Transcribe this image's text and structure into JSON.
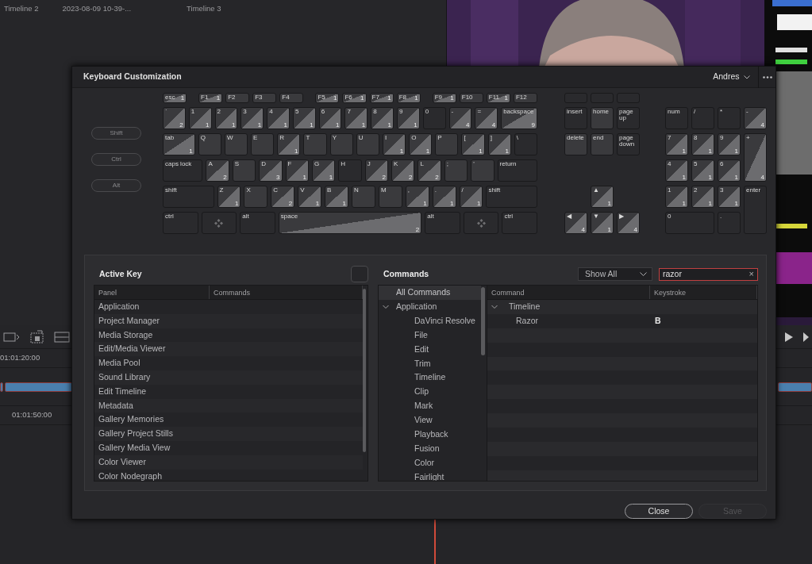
{
  "media_pool": {
    "clips": [
      {
        "name": "Timeline 2"
      },
      {
        "name": "2023-08-09 10-39-..."
      },
      {
        "name": "Timeline 3"
      }
    ]
  },
  "timeline": {
    "timecodes": [
      "01:01:20:00",
      "01:01:50:00"
    ]
  },
  "dialog": {
    "title": "Keyboard Customization",
    "preset": "Andres",
    "modifiers": [
      {
        "label": "Shift"
      },
      {
        "label": "Ctrl"
      },
      {
        "label": "Alt"
      }
    ],
    "keyboard": {
      "main": [
        [
          {
            "kind": "key",
            "label": "esc",
            "count": "1"
          },
          {
            "kind": "key",
            "label": "F1",
            "count": "1"
          },
          {
            "kind": "key",
            "label": "F2"
          },
          {
            "kind": "key",
            "label": "F3"
          },
          {
            "kind": "key",
            "label": "F4"
          },
          {
            "kind": "key",
            "label": "F5",
            "count": "1"
          },
          {
            "kind": "key",
            "label": "F6",
            "count": "1"
          },
          {
            "kind": "key",
            "label": "F7",
            "count": "1"
          },
          {
            "kind": "key",
            "label": "F8",
            "count": "1"
          },
          {
            "kind": "key",
            "label": "F9",
            "count": "1"
          },
          {
            "kind": "key",
            "label": "F10"
          },
          {
            "kind": "key",
            "label": "F11",
            "count": "1"
          },
          {
            "kind": "key",
            "label": "F12"
          }
        ],
        [
          {
            "kind": "key",
            "label": "`",
            "count": "2"
          },
          {
            "kind": "key",
            "label": "1",
            "count": "1"
          },
          {
            "kind": "key",
            "label": "2",
            "count": "1"
          },
          {
            "kind": "key",
            "label": "3",
            "count": "1"
          },
          {
            "kind": "key",
            "label": "4",
            "count": "1"
          },
          {
            "kind": "key",
            "label": "5",
            "count": "1"
          },
          {
            "kind": "key",
            "label": "6",
            "count": "1"
          },
          {
            "kind": "key",
            "label": "7",
            "count": "1"
          },
          {
            "kind": "key",
            "label": "8",
            "count": "1"
          },
          {
            "kind": "key",
            "label": "9",
            "count": "1"
          },
          {
            "kind": "key",
            "label": "0",
            "dim": true
          },
          {
            "kind": "key",
            "label": "-",
            "count": "4"
          },
          {
            "kind": "key",
            "label": "=",
            "count": "4"
          },
          {
            "kind": "key",
            "label": "backspace",
            "count": "9"
          }
        ],
        [
          {
            "kind": "key",
            "label": "tab",
            "count": "1"
          },
          {
            "kind": "key",
            "label": "Q"
          },
          {
            "kind": "key",
            "label": "W"
          },
          {
            "kind": "key",
            "label": "E"
          },
          {
            "kind": "key",
            "label": "R",
            "count": "1"
          },
          {
            "kind": "key",
            "label": "T"
          },
          {
            "kind": "key",
            "label": "Y"
          },
          {
            "kind": "key",
            "label": "U"
          },
          {
            "kind": "key",
            "label": "I",
            "count": "1"
          },
          {
            "kind": "key",
            "label": "O",
            "count": "1"
          },
          {
            "kind": "key",
            "label": "P"
          },
          {
            "kind": "key",
            "label": "[",
            "count": "1"
          },
          {
            "kind": "key",
            "label": "]",
            "count": "1"
          },
          {
            "kind": "key",
            "label": "\\",
            "dim": true
          }
        ],
        [
          {
            "kind": "key",
            "label": "caps lock",
            "dim": true
          },
          {
            "kind": "key",
            "label": "A",
            "count": "2"
          },
          {
            "kind": "key",
            "label": "S"
          },
          {
            "kind": "key",
            "label": "D",
            "count": "3"
          },
          {
            "kind": "key",
            "label": "F",
            "count": "1"
          },
          {
            "kind": "key",
            "label": "G",
            "count": "1"
          },
          {
            "kind": "key",
            "label": "H",
            "dim": true
          },
          {
            "kind": "key",
            "label": "J",
            "count": "2"
          },
          {
            "kind": "key",
            "label": "K",
            "count": "2"
          },
          {
            "kind": "key",
            "label": "L",
            "count": "2"
          },
          {
            "kind": "key",
            "label": ";"
          },
          {
            "kind": "key",
            "label": "'"
          },
          {
            "kind": "key",
            "label": "return",
            "dim": true
          }
        ],
        [
          {
            "kind": "key",
            "label": "shift",
            "dim": true
          },
          {
            "kind": "key",
            "label": "Z",
            "count": "1"
          },
          {
            "kind": "key",
            "label": "X"
          },
          {
            "kind": "key",
            "label": "C",
            "count": "2"
          },
          {
            "kind": "key",
            "label": "V",
            "count": "1"
          },
          {
            "kind": "key",
            "label": "B",
            "count": "1"
          },
          {
            "kind": "key",
            "label": "N"
          },
          {
            "kind": "key",
            "label": "M"
          },
          {
            "kind": "key",
            "label": ",",
            "count": "1"
          },
          {
            "kind": "key",
            "label": ".",
            "count": "1"
          },
          {
            "kind": "key",
            "label": "/",
            "count": "1"
          },
          {
            "kind": "key",
            "label": "shift",
            "dim": true
          }
        ],
        [
          {
            "kind": "key",
            "label": "ctrl",
            "dim": true
          },
          {
            "kind": "icon",
            "dim": true
          },
          {
            "kind": "key",
            "label": "alt",
            "dim": true
          },
          {
            "kind": "key",
            "label": "space",
            "count": "2"
          },
          {
            "kind": "key",
            "label": "alt",
            "dim": true
          },
          {
            "kind": "icon",
            "dim": true
          },
          {
            "kind": "key",
            "label": "ctrl",
            "dim": true
          }
        ]
      ],
      "nav": [
        {
          "kind": "blank",
          "dim": true
        },
        {
          "kind": "blank",
          "dim": true
        },
        {
          "kind": "blank",
          "dim": true
        },
        {
          "kind": "key",
          "label": "insert",
          "dim": true
        },
        {
          "kind": "key",
          "label": "home"
        },
        {
          "kind": "key",
          "label": "page up",
          "dim": true
        },
        {
          "kind": "key",
          "label": "delete"
        },
        {
          "kind": "key",
          "label": "end"
        },
        {
          "kind": "key",
          "label": "page down",
          "dim": true
        },
        {
          "kind": "key",
          "label": "▲",
          "count": "1"
        },
        {
          "kind": "key",
          "label": "◀",
          "count": "4"
        },
        {
          "kind": "key",
          "label": "▼",
          "count": "1"
        },
        {
          "kind": "key",
          "label": "▶",
          "count": "4"
        }
      ],
      "numpad": [
        [
          {
            "kind": "key",
            "label": "num",
            "dim": true
          },
          {
            "kind": "key",
            "label": "/",
            "dim": true
          },
          {
            "kind": "key",
            "label": "*",
            "dim": true
          },
          {
            "kind": "key",
            "label": "-",
            "count": "4"
          }
        ],
        [
          {
            "kind": "key",
            "label": "7",
            "count": "1"
          },
          {
            "kind": "key",
            "label": "8",
            "count": "1"
          },
          {
            "kind": "key",
            "label": "9",
            "count": "1"
          },
          {
            "kind": "key",
            "label": "+",
            "count": "4"
          }
        ],
        [
          {
            "kind": "key",
            "label": "4",
            "count": "1"
          },
          {
            "kind": "key",
            "label": "5",
            "count": "1"
          },
          {
            "kind": "key",
            "label": "6",
            "count": "1"
          }
        ],
        [
          {
            "kind": "key",
            "label": "1",
            "count": "1"
          },
          {
            "kind": "key",
            "label": "2",
            "count": "1"
          },
          {
            "kind": "key",
            "label": "3",
            "count": "1"
          },
          {
            "kind": "key",
            "label": "enter",
            "dim": true
          }
        ],
        [
          {
            "kind": "key",
            "label": "0",
            "dim": true
          },
          {
            "kind": "key",
            "label": ".",
            "dim": true
          }
        ]
      ]
    },
    "active_key": {
      "title": "Active Key",
      "columns": [
        "Panel",
        "Commands"
      ],
      "rows": [
        {
          "panel": "Application"
        },
        {
          "panel": "Project Manager"
        },
        {
          "panel": "Media Storage"
        },
        {
          "panel": "Edit/Media Viewer"
        },
        {
          "panel": "Media Pool"
        },
        {
          "panel": "Sound Library"
        },
        {
          "panel": "Edit Timeline"
        },
        {
          "panel": "Metadata"
        },
        {
          "panel": "Gallery Memories"
        },
        {
          "panel": "Gallery Project Stills"
        },
        {
          "panel": "Gallery Media View"
        },
        {
          "panel": "Color Viewer"
        },
        {
          "panel": "Color Nodegraph"
        }
      ]
    },
    "commands": {
      "title": "Commands",
      "filter": "Show All",
      "search": "razor",
      "clear_glyph": "×",
      "tree": [
        {
          "label": "All Commands",
          "selected": true
        },
        {
          "label": "Application",
          "selected": false,
          "expanded": true,
          "children": [
            {
              "label": "DaVinci Resolve",
              "selected": false
            },
            {
              "label": "File",
              "selected": false
            },
            {
              "label": "Edit",
              "selected": false
            },
            {
              "label": "Trim",
              "selected": false
            },
            {
              "label": "Timeline",
              "selected": false
            },
            {
              "label": "Clip",
              "selected": false
            },
            {
              "label": "Mark",
              "selected": false
            },
            {
              "label": "View",
              "selected": false
            },
            {
              "label": "Playback",
              "selected": false
            },
            {
              "label": "Fusion",
              "selected": false
            },
            {
              "label": "Color",
              "selected": false
            },
            {
              "label": "Fairlight",
              "selected": false
            }
          ]
        }
      ],
      "columns": [
        "Command",
        "Keystroke"
      ],
      "results": [
        {
          "group": "Timeline",
          "expanded": true,
          "children": [
            {
              "command": "Razor",
              "keystroke": "B"
            }
          ]
        }
      ]
    },
    "buttons": [
      {
        "label": "Close",
        "disabled": false
      },
      {
        "label": "Save",
        "disabled": true
      }
    ]
  }
}
